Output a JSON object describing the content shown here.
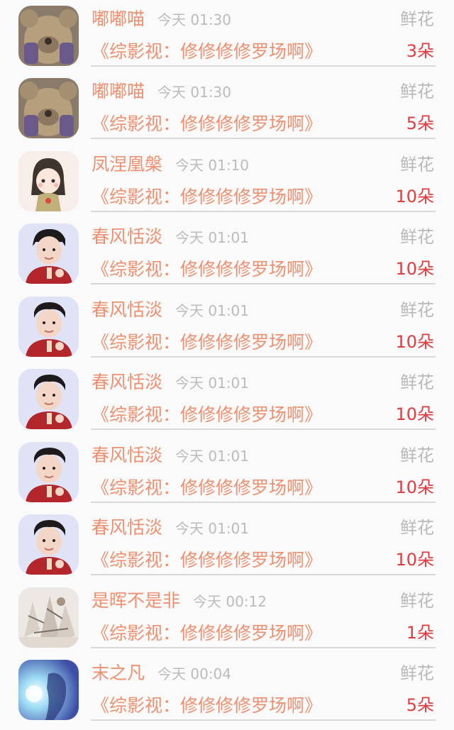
{
  "gift_records": [
    {
      "user": "嘟嘟喵",
      "time": "今天 01:30",
      "gift": "鲜花",
      "book": "《综影视：修修修修罗场啊》",
      "count": "3朵",
      "avatar": "bear-avatar"
    },
    {
      "user": "嘟嘟喵",
      "time": "今天 01:30",
      "gift": "鲜花",
      "book": "《综影视：修修修修罗场啊》",
      "count": "5朵",
      "avatar": "bear-avatar"
    },
    {
      "user": "凤涅凰槃",
      "time": "今天 01:10",
      "gift": "鲜花",
      "book": "《综影视：修修修修罗场啊》",
      "count": "10朵",
      "avatar": "anime-girl-avatar"
    },
    {
      "user": "春风恬淡",
      "time": "今天 01:01",
      "gift": "鲜花",
      "book": "《综影视：修修修修罗场啊》",
      "count": "10朵",
      "avatar": "man-portrait-avatar"
    },
    {
      "user": "春风恬淡",
      "time": "今天 01:01",
      "gift": "鲜花",
      "book": "《综影视：修修修修罗场啊》",
      "count": "10朵",
      "avatar": "man-portrait-avatar"
    },
    {
      "user": "春风恬淡",
      "time": "今天 01:01",
      "gift": "鲜花",
      "book": "《综影视：修修修修罗场啊》",
      "count": "10朵",
      "avatar": "man-portrait-avatar"
    },
    {
      "user": "春风恬淡",
      "time": "今天 01:01",
      "gift": "鲜花",
      "book": "《综影视：修修修修罗场啊》",
      "count": "10朵",
      "avatar": "man-portrait-avatar"
    },
    {
      "user": "春风恬淡",
      "time": "今天 01:01",
      "gift": "鲜花",
      "book": "《综影视：修修修修罗场啊》",
      "count": "10朵",
      "avatar": "man-portrait-avatar"
    },
    {
      "user": "是晖不是非",
      "time": "今天 00:12",
      "gift": "鲜花",
      "book": "《综影视：修修修修罗场啊》",
      "count": "1朵",
      "avatar": "sketch-art-avatar"
    },
    {
      "user": "末之凡",
      "time": "今天 00:04",
      "gift": "鲜花",
      "book": "《综影视：修修修修罗场啊》",
      "count": "5朵",
      "avatar": "blue-art-avatar"
    }
  ],
  "colors": {
    "accent_orange": "#ee9070",
    "count_red": "#e03c40",
    "muted_gray": "#bbbbbb",
    "background": "#fbfafa"
  }
}
